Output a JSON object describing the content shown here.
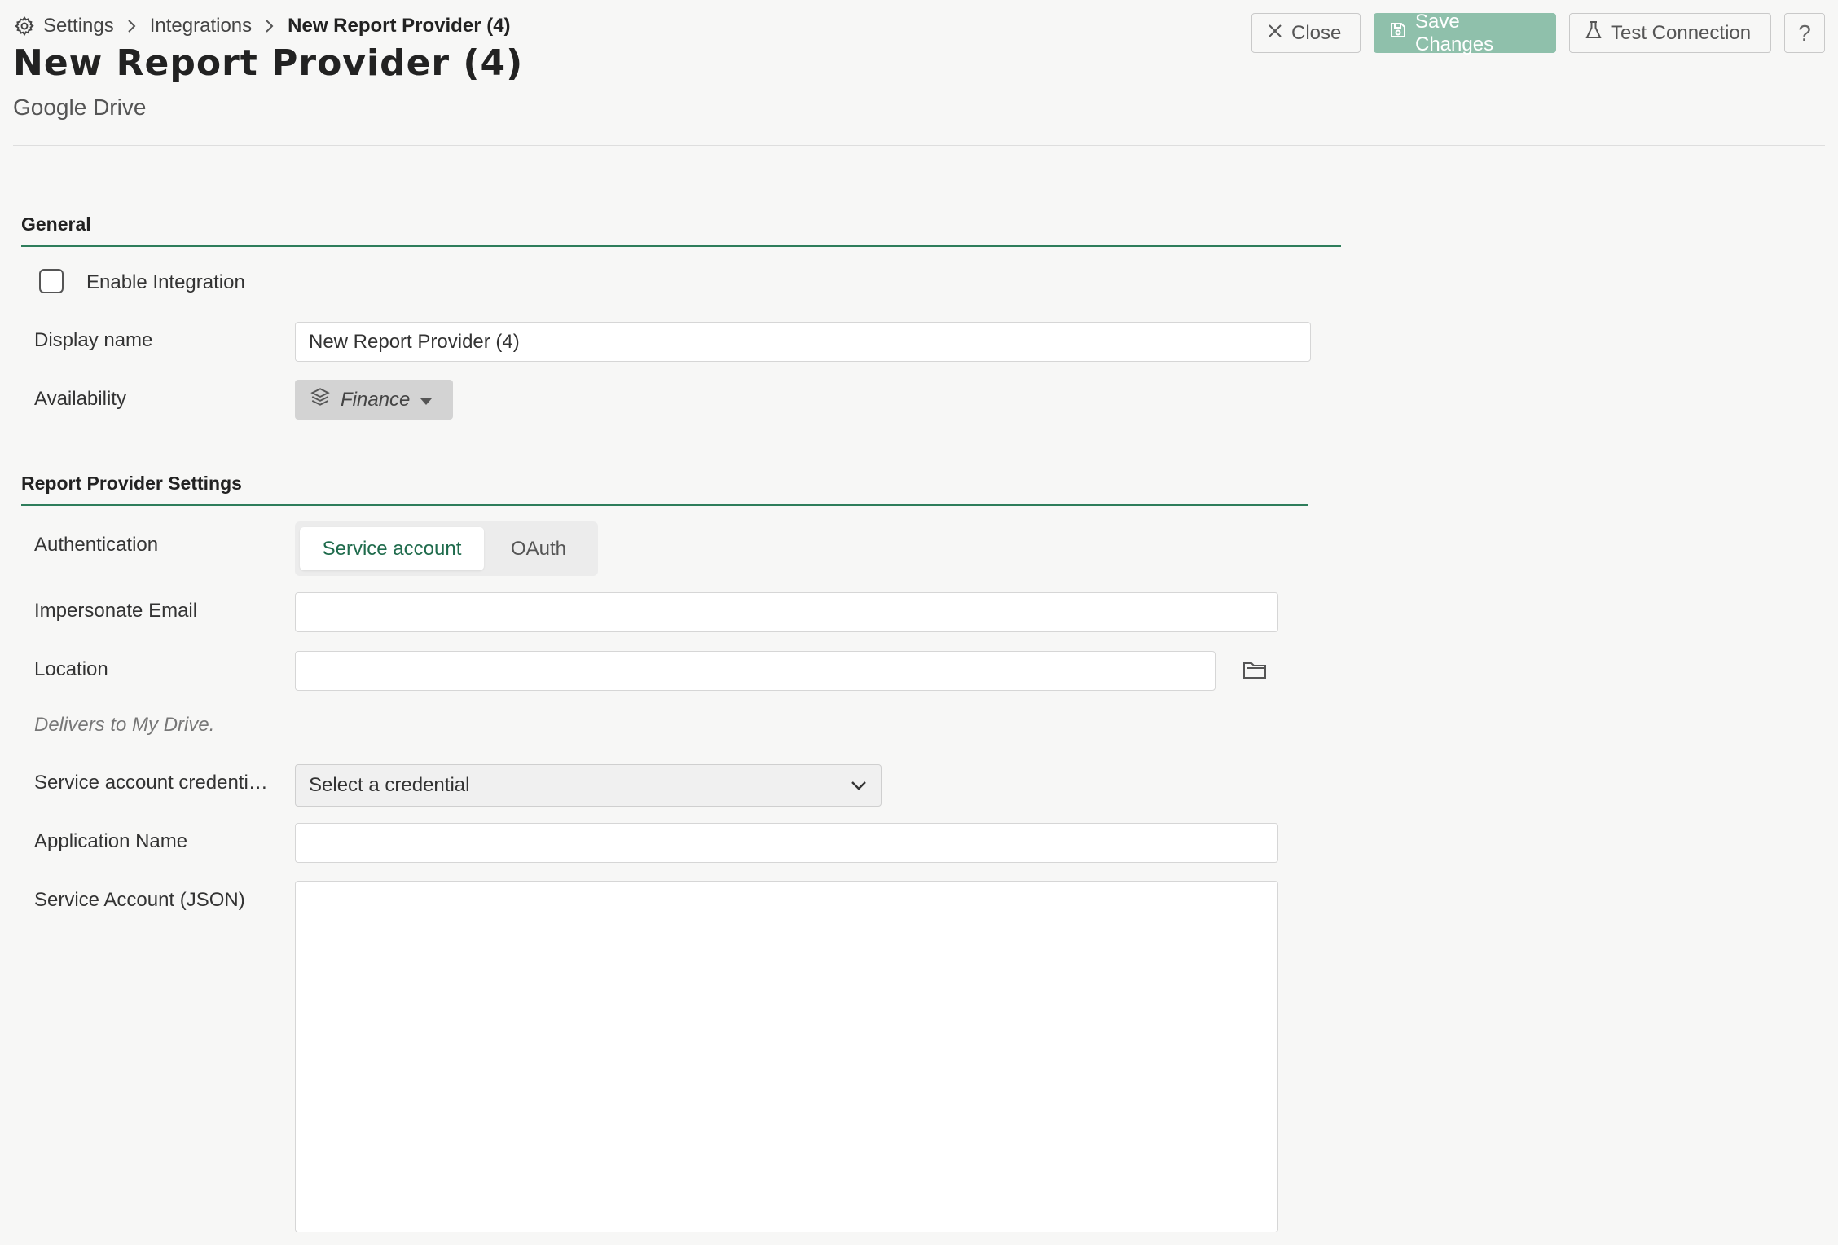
{
  "breadcrumb": {
    "items": [
      "Settings",
      "Integrations",
      "New Report Provider (4)"
    ]
  },
  "header": {
    "title": "New Report Provider (4)",
    "subtitle": "Google Drive"
  },
  "toolbar": {
    "close_label": "Close",
    "save_label": "Save Changes",
    "test_label": "Test Connection",
    "help_label": "?"
  },
  "general": {
    "section_title": "General",
    "enable_label": "Enable Integration",
    "enable_checked": false,
    "display_name_label": "Display name",
    "display_name_value": "New Report Provider (4)",
    "availability_label": "Availability",
    "availability_value": "Finance"
  },
  "provider_settings": {
    "section_title": "Report Provider Settings",
    "authentication_label": "Authentication",
    "auth_options": [
      "Service account",
      "OAuth"
    ],
    "auth_selected": "Service account",
    "impersonate_label": "Impersonate Email",
    "impersonate_value": "",
    "location_label": "Location",
    "location_value": "",
    "location_hint": "Delivers to My Drive.",
    "credential_label": "Service account credenti…",
    "credential_value": "Select a credential",
    "application_name_label": "Application Name",
    "application_name_value": "",
    "service_account_json_label": "Service Account (JSON)",
    "service_account_json_value": ""
  },
  "colors": {
    "accent": "#2e7d5b",
    "save_button_bg": "#8fc0ab",
    "background": "#f7f7f6"
  }
}
